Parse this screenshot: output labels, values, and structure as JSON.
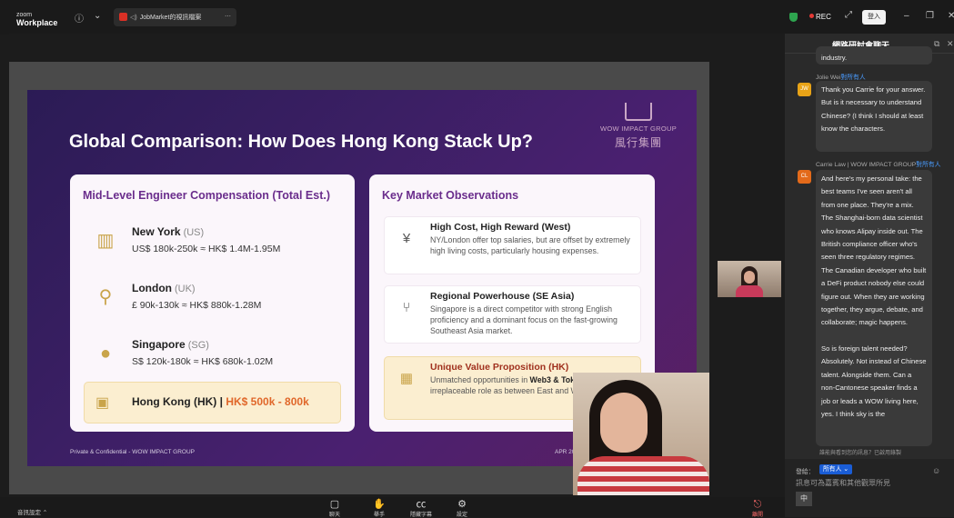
{
  "app": {
    "brand_small": "zoom",
    "brand_name": "Workplace"
  },
  "tab": {
    "title": "JobMarket的視訊檔案"
  },
  "header": {
    "rec_label": "REC",
    "login_label": "登入"
  },
  "slide": {
    "title": "Global Comparison: How Does Hong Kong Stack Up?",
    "brand_en": "WOW IMPACT GROUP",
    "brand_zh": "風行集團",
    "left_heading": "Mid-Level Engineer Compensation (Total Est.)",
    "rows": [
      {
        "name": "New York",
        "code": "(US)",
        "value": "US$ 180k-250k ≈ HK$ 1.4M-1.95M"
      },
      {
        "name": "London",
        "code": "(UK)",
        "value": "£ 90k-130k ≈ HK$ 880k-1.28M"
      },
      {
        "name": "Singapore",
        "code": "(SG)",
        "value": "S$ 120k-180k ≈ HK$ 680k-1.02M"
      }
    ],
    "hk_label": "Hong Kong (HK) |",
    "hk_value": "HK$ 500k - 800k",
    "right_heading": "Key Market Observations",
    "observations": [
      {
        "heading": "High Cost, High Reward (West)",
        "text": "NY/London offer top salaries, but are offset by extremely high living costs, particularly housing expenses."
      },
      {
        "heading": "Regional Powerhouse (SE Asia)",
        "text": "Singapore is a direct competitor with strong English proficiency and a dominant focus on the fast-growing Southeast Asia market."
      },
      {
        "heading": "Unique Value Proposition (HK)",
        "text_a": "Unmatched opportunities in ",
        "text_b": "Web3 & Tokenization",
        "text_c": ", plus its irreplaceable role as between East and West markets."
      }
    ],
    "footer_left": "Private & Confidential - WOW IMPACT GROUP",
    "footer_right": "APR 2026"
  },
  "chat": {
    "title": "網路研討會聊天",
    "top_fragment": "industry.",
    "messages": [
      {
        "sender": "Jolie Wei",
        "to": "對所有人",
        "initials": "JW",
        "avatar_color": "#e8a317",
        "text": "Thank you Carrie for your answer. But is it necessary to understand Chinese? (I think I should at least know the characters."
      },
      {
        "sender": "Carrie Law | WOW IMPACT GROUP",
        "to": "對所有人",
        "initials": "CL",
        "avatar_color": "#e36a1a",
        "text": "And here's my personal take: the best teams I've seen aren't all from one place. They're a mix. The Shanghai-born data scientist who knows Alipay inside out. The British compliance officer who's seen three regulatory regimes. The Canadian developer who built a DeFi product nobody else could figure out. When they are working together, they argue, debate, and collaborate; magic happens.",
        "text2": "So is foreign talent needed? Absolutely. Not instead of Chinese talent. Alongside them. Can a non-Cantonese speaker finds a job or leads a WOW living here, yes.  I think sky is the"
      }
    ],
    "notice": "誰能與看到您的訊息？已啟用錄製",
    "send_to_label": "發給：",
    "send_to_value": "所有人",
    "input_placeholder": "訊息可為嘉賓和其他觀眾所見",
    "ime_label": "中"
  },
  "toolbar": {
    "audio_label": "音訊設定",
    "items": [
      "聊天",
      "舉手",
      "隱藏字幕",
      "設定"
    ],
    "leave_label": "離開"
  },
  "icons": [
    "info-icon",
    "chevron-down-icon",
    "pdf-icon",
    "speaker-icon",
    "more-icon",
    "shield-icon",
    "expand-icon",
    "minimize-icon",
    "restore-icon",
    "close-icon",
    "popout-icon",
    "chat-icon",
    "hand-icon",
    "cc-icon",
    "gear-icon",
    "building-icon",
    "pin-icon",
    "globe-icon",
    "wallet-icon",
    "currency-icon",
    "branch-icon",
    "chip-icon"
  ]
}
